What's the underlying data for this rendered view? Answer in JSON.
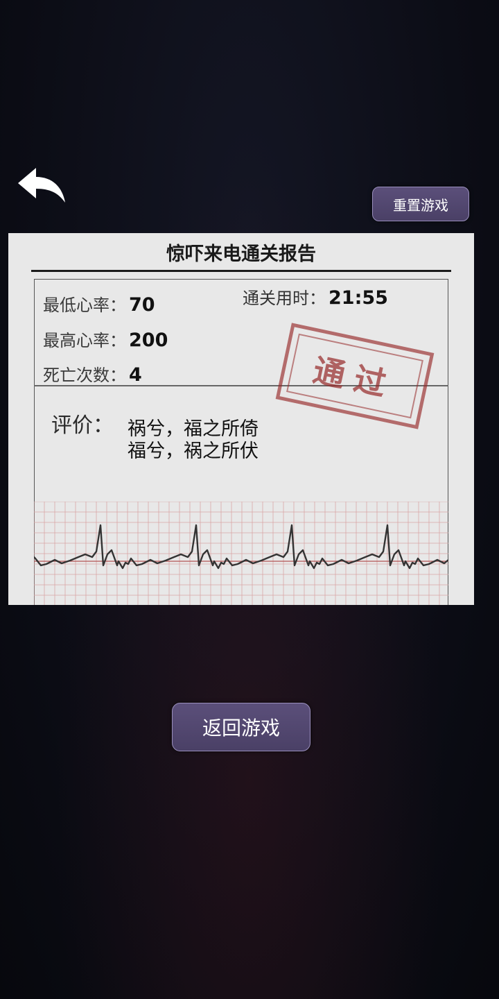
{
  "header": {
    "reset_label": "重置游戏"
  },
  "report": {
    "title": "惊吓来电通关报告",
    "stats": {
      "min_hr_label": "最低心率：",
      "min_hr_value": "70",
      "max_hr_label": "最高心率：",
      "max_hr_value": "200",
      "deaths_label": "死亡次数：",
      "deaths_value": "4",
      "time_label": "通关用时：",
      "time_value": "21:55"
    },
    "stamp_text": "通过",
    "evaluation": {
      "label": "评价：",
      "line1": "祸兮，福之所倚",
      "line2": "福兮，祸之所伏"
    }
  },
  "footer": {
    "return_label": "返回游戏"
  },
  "colors": {
    "button_bg": "#4f4470",
    "stamp": "#962828",
    "ecg_grid": "#d9a0a0",
    "ecg_line": "#333333"
  }
}
